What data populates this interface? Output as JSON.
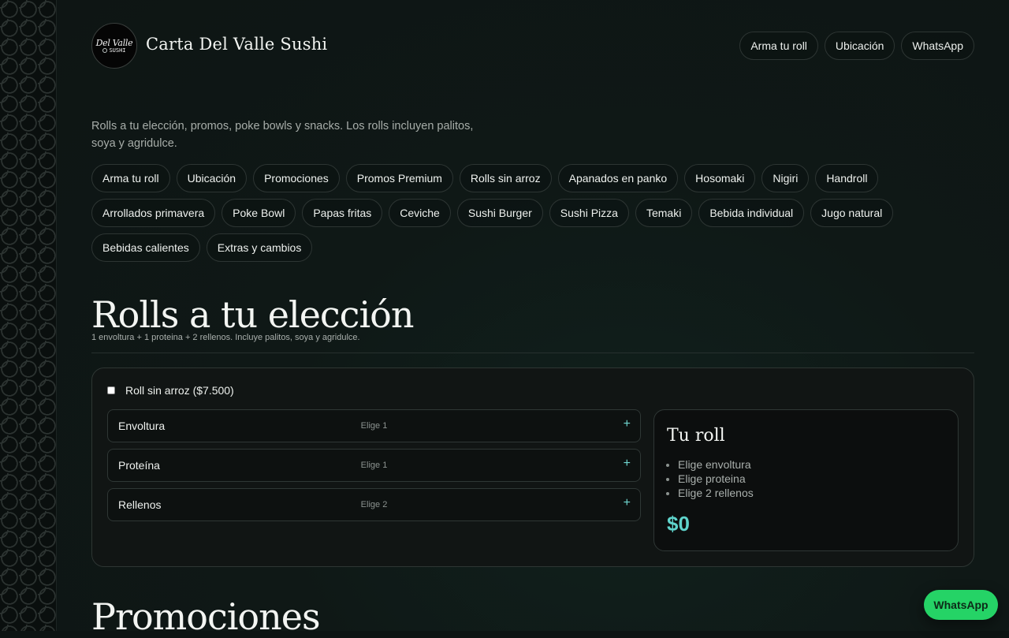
{
  "header": {
    "logo_line1": "Del Valle",
    "logo_line2": "SUSHI",
    "title": "Carta Del Valle Sushi",
    "nav": [
      "Arma tu roll",
      "Ubicación",
      "WhatsApp"
    ]
  },
  "intro": "Rolls a tu elección, promos, poke bowls y snacks. Los rolls incluyen palitos, soya y agridulce.",
  "categories": [
    "Arma tu roll",
    "Ubicación",
    "Promociones",
    "Promos Premium",
    "Rolls sin arroz",
    "Apanados en panko",
    "Hosomaki",
    "Nigiri",
    "Handroll",
    "Arrollados primavera",
    "Poke Bowl",
    "Papas fritas",
    "Ceviche",
    "Sushi Burger",
    "Sushi Pizza",
    "Temaki",
    "Bebida individual",
    "Jugo natural",
    "Bebidas calientes",
    "Extras y cambios"
  ],
  "section": {
    "title": "Rolls a tu elección",
    "subtitle": "1 envoltura + 1 proteina + 2 rellenos. Incluye palitos, soya y agridulce."
  },
  "builder": {
    "no_rice_label": "Roll sin arroz ($7.500)",
    "no_rice_checked": false,
    "options": [
      {
        "label": "Envoltura",
        "hint": "Elige 1"
      },
      {
        "label": "Proteína",
        "hint": "Elige 1"
      },
      {
        "label": "Rellenos",
        "hint": "Elige 2"
      }
    ],
    "plus_symbol": "+"
  },
  "summary": {
    "title": "Tu roll",
    "items": [
      "Elige envoltura",
      "Elige proteina",
      "Elige 2 rellenos"
    ],
    "price": "$0"
  },
  "next_section_title": "Promociones",
  "whatsapp_float": "WhatsApp",
  "colors": {
    "accent": "#5fd3cb",
    "whatsapp": "#25d366",
    "background": "#0e1514"
  }
}
